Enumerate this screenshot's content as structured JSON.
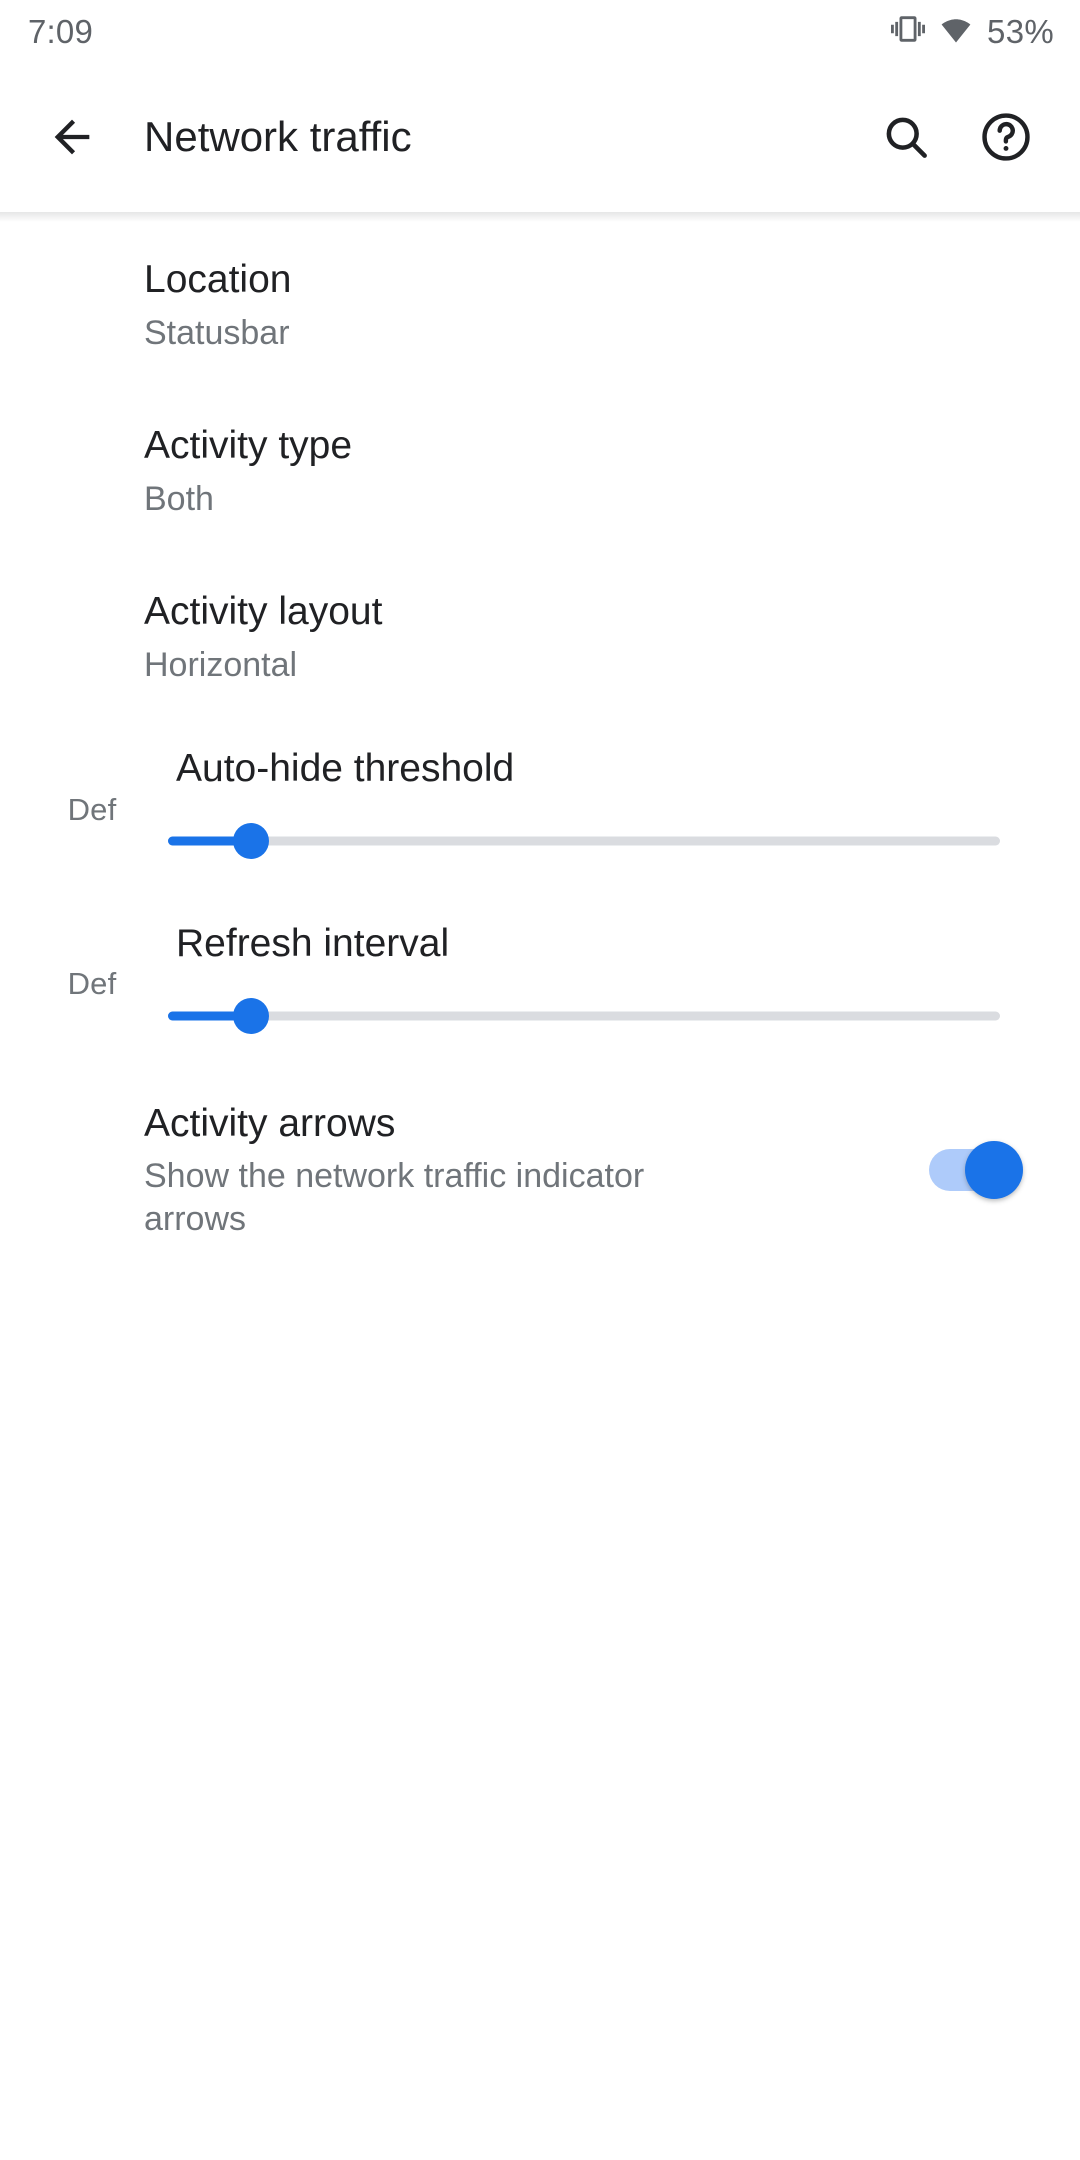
{
  "statusbar": {
    "time": "7:09",
    "battery": "53%",
    "vibrate_icon": "vibrate-icon",
    "wifi_icon": "wifi-icon"
  },
  "appbar": {
    "back_icon": "back-arrow-icon",
    "title": "Network traffic",
    "search_icon": "search-icon",
    "help_icon": "help-circle-icon"
  },
  "preferences": [
    {
      "key": "location",
      "type": "list",
      "title": "Location",
      "summary": "Statusbar"
    },
    {
      "key": "activity_type",
      "type": "list",
      "title": "Activity type",
      "summary": "Both"
    },
    {
      "key": "activity_layout",
      "type": "list",
      "title": "Activity layout",
      "summary": "Horizontal"
    },
    {
      "key": "auto_hide_threshold",
      "type": "slider",
      "title": "Auto-hide threshold",
      "left_label": "Def",
      "percent": 10
    },
    {
      "key": "refresh_interval",
      "type": "slider",
      "title": "Refresh interval",
      "left_label": "Def",
      "percent": 10
    },
    {
      "key": "activity_arrows",
      "type": "switch",
      "title": "Activity arrows",
      "summary": "Show the network traffic indicator arrows",
      "checked": true
    }
  ],
  "colors": {
    "accent": "#1a73e8",
    "accent_track": "#aecbfa",
    "track": "#dadce0",
    "primary_text": "#202124",
    "secondary_text": "#70757a",
    "status_text": "#5f6368",
    "background": "#ffffff"
  }
}
